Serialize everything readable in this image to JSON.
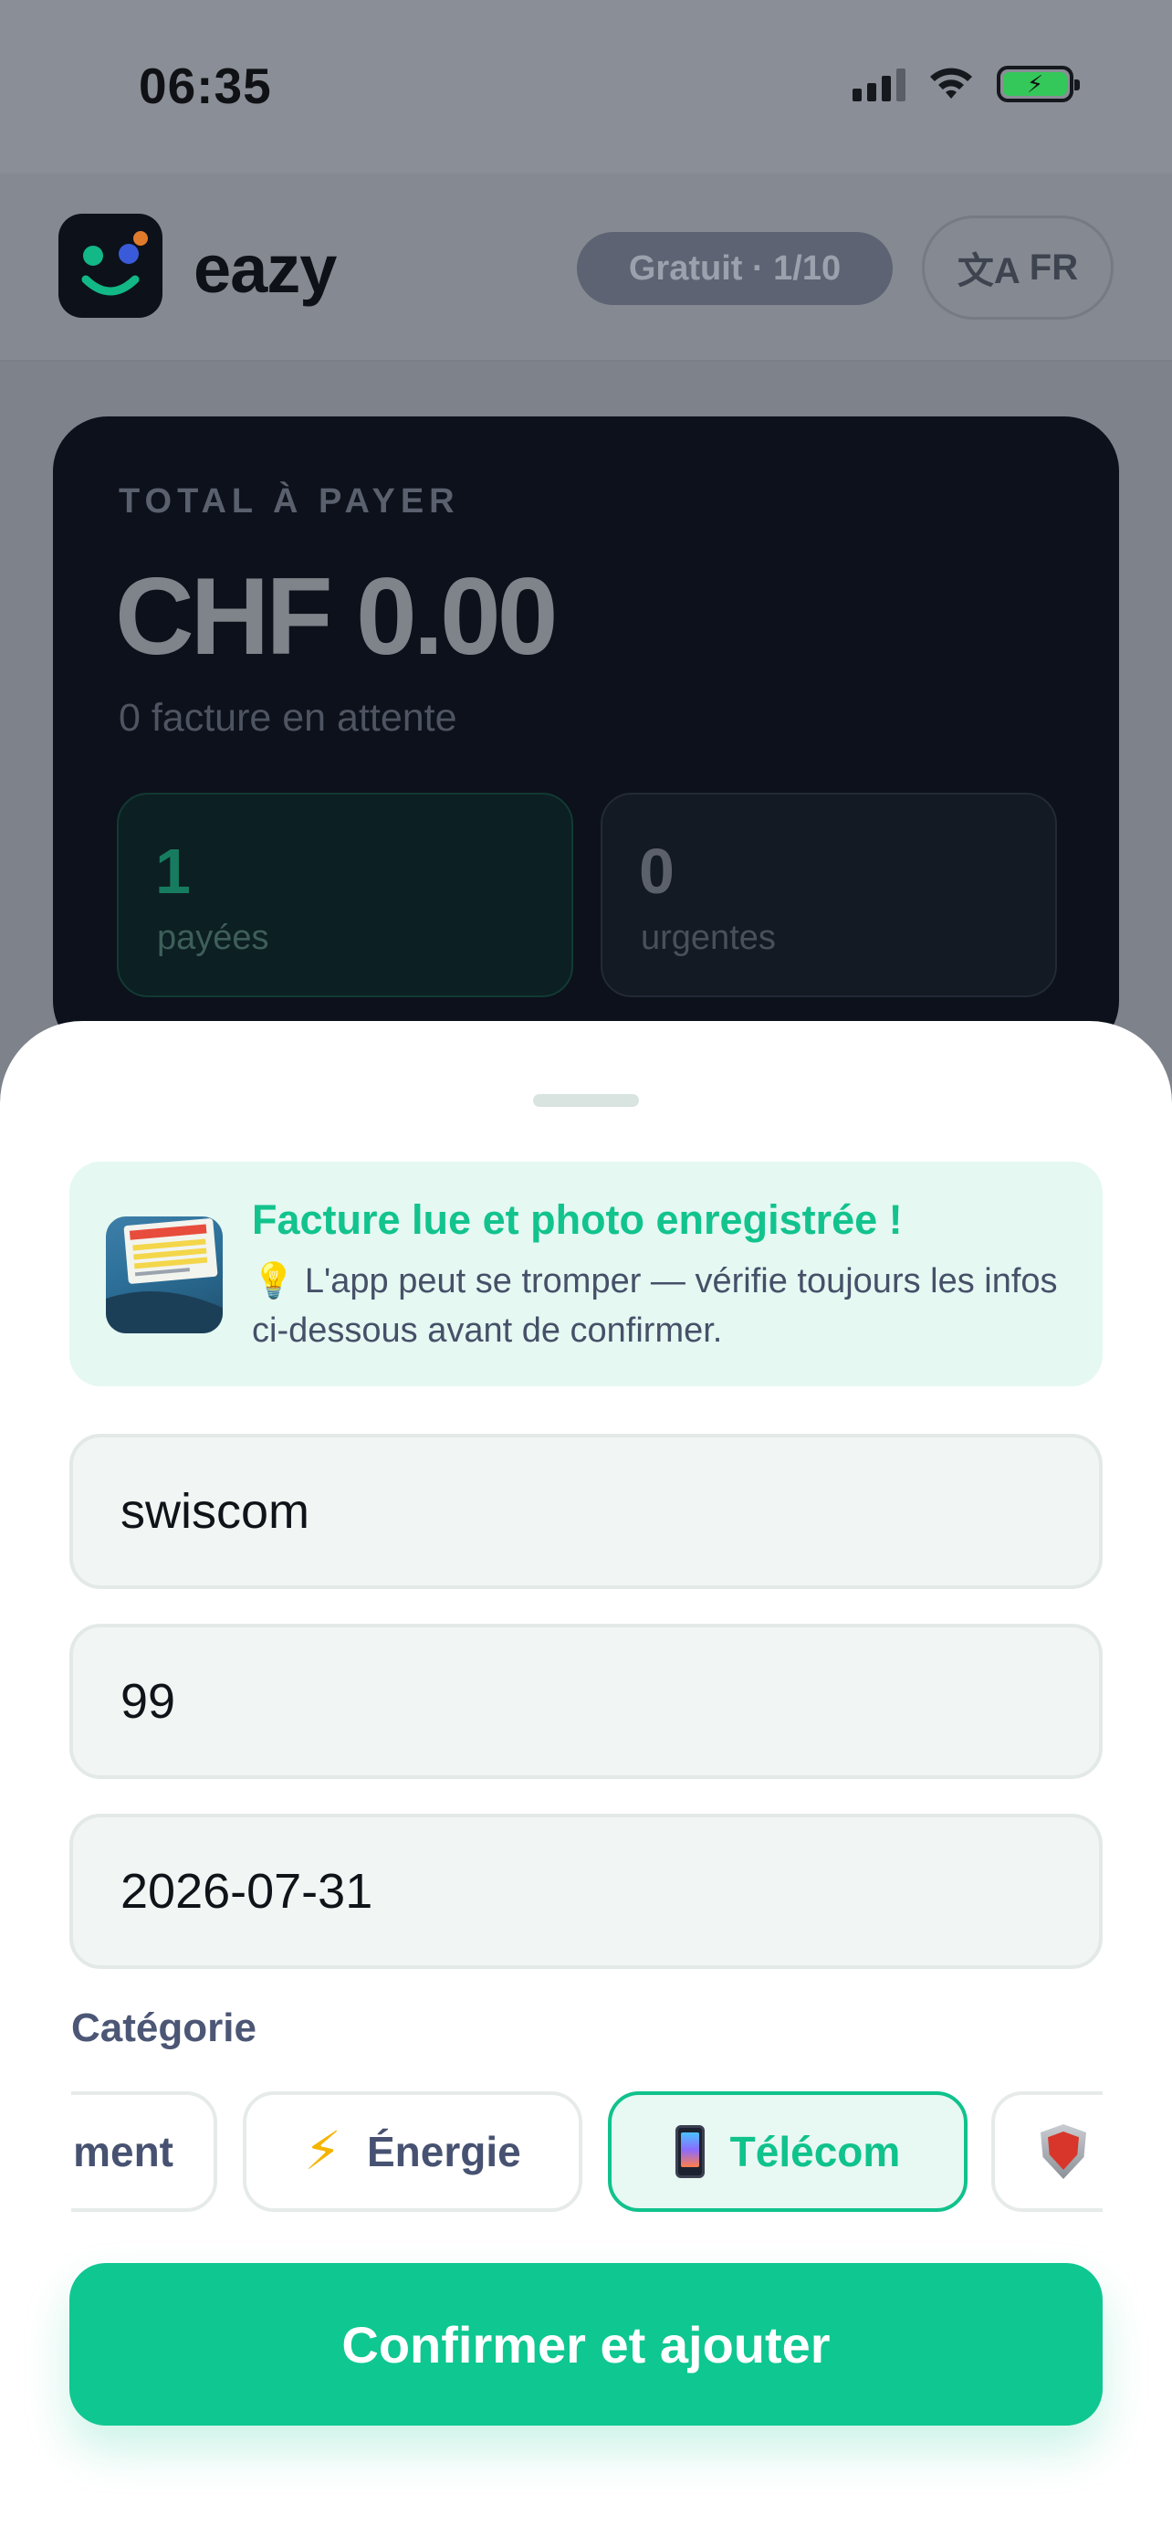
{
  "status_bar": {
    "time": "06:35"
  },
  "header": {
    "brand": "eazy",
    "plan_badge": "Gratuit · 1/10",
    "language": {
      "icon": "translate-icon",
      "glyph": "文A",
      "code": "FR"
    }
  },
  "summary": {
    "label": "TOTAL À PAYER",
    "amount": "CHF 0.00",
    "pending": "0 facture en attente",
    "stats": [
      {
        "value": "1",
        "label": "payées"
      },
      {
        "value": "0",
        "label": "urgentes"
      }
    ]
  },
  "sheet": {
    "notice": {
      "title": "Facture lue et photo enregistrée !",
      "icon": "💡",
      "body": "L'app peut se tromper — vérifie toujours les infos ci-dessous avant de confirmer."
    },
    "fields": {
      "name": "swiscom",
      "amount": "99",
      "date": "2026-07-31"
    },
    "category": {
      "title": "Catégorie",
      "chips": [
        {
          "label": "ment",
          "icon": ""
        },
        {
          "label": "Énergie",
          "icon": "⚡"
        },
        {
          "label": "Télécom",
          "icon": "phone-icon",
          "selected": true
        },
        {
          "label": "",
          "icon": "shield-icon"
        }
      ]
    },
    "confirm_label": "Confirmer et ajouter"
  },
  "colors": {
    "accent": "#0fc791",
    "dark_card": "#0c111b",
    "notice_bg": "#e5f8f2"
  }
}
